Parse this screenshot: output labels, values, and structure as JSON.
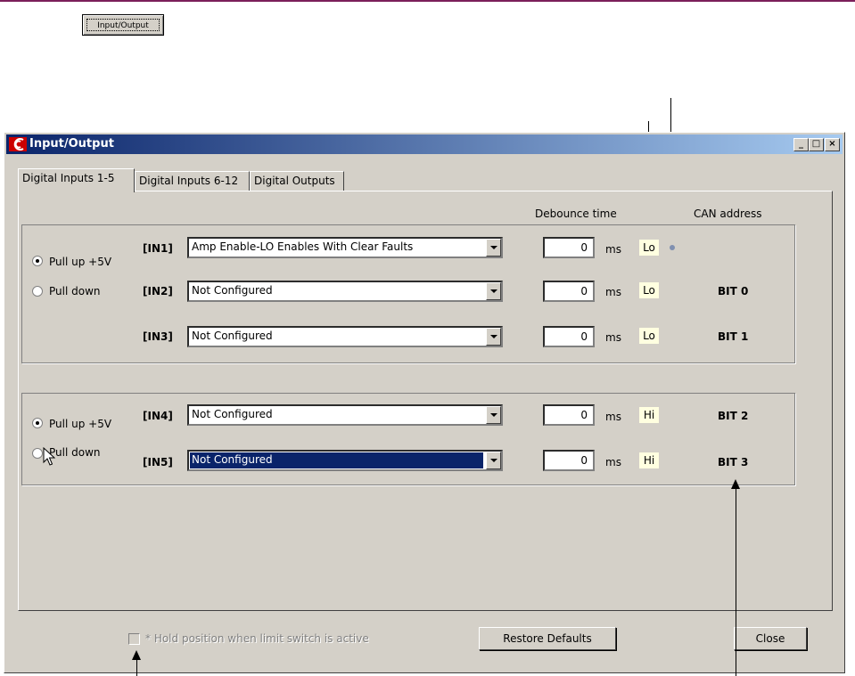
{
  "doc": {
    "mini_button_label": "Input/Output"
  },
  "window": {
    "title": "Input/Output",
    "controls": {
      "minimize": "_",
      "maximize": "□",
      "close": "×"
    }
  },
  "tabs": [
    {
      "label": "Digital Inputs 1-5",
      "active": true
    },
    {
      "label": "Digital Inputs 6-12",
      "active": false
    },
    {
      "label": "Digital Outputs",
      "active": false
    }
  ],
  "headers": {
    "debounce": "Debounce time",
    "can_address": "CAN address"
  },
  "groups": [
    {
      "pull_up_label": "Pull up +5V",
      "pull_down_label": "Pull down",
      "selected": "pull_up",
      "inputs": [
        {
          "label": "[IN1]",
          "function": "Amp Enable-LO Enables With Clear Faults",
          "debounce": "0",
          "unit": "ms",
          "state": "Lo",
          "can": ""
        },
        {
          "label": "[IN2]",
          "function": "Not Configured",
          "debounce": "0",
          "unit": "ms",
          "state": "Lo",
          "can": "BIT 0"
        },
        {
          "label": "[IN3]",
          "function": "Not Configured",
          "debounce": "0",
          "unit": "ms",
          "state": "Lo",
          "can": "BIT 1"
        }
      ]
    },
    {
      "pull_up_label": "Pull up +5V",
      "pull_down_label": "Pull down",
      "selected": "pull_up",
      "inputs": [
        {
          "label": "[IN4]",
          "function": "Not Configured",
          "debounce": "0",
          "unit": "ms",
          "state": "Hi",
          "can": "BIT 2"
        },
        {
          "label": "[IN5]",
          "function": "Not Configured",
          "debounce": "0",
          "unit": "ms",
          "state": "Hi",
          "can": "BIT 3"
        }
      ]
    }
  ],
  "footer": {
    "hold_checkbox_label": "* Hold position when limit switch is active",
    "restore_label": "Restore Defaults",
    "close_label": "Close"
  }
}
